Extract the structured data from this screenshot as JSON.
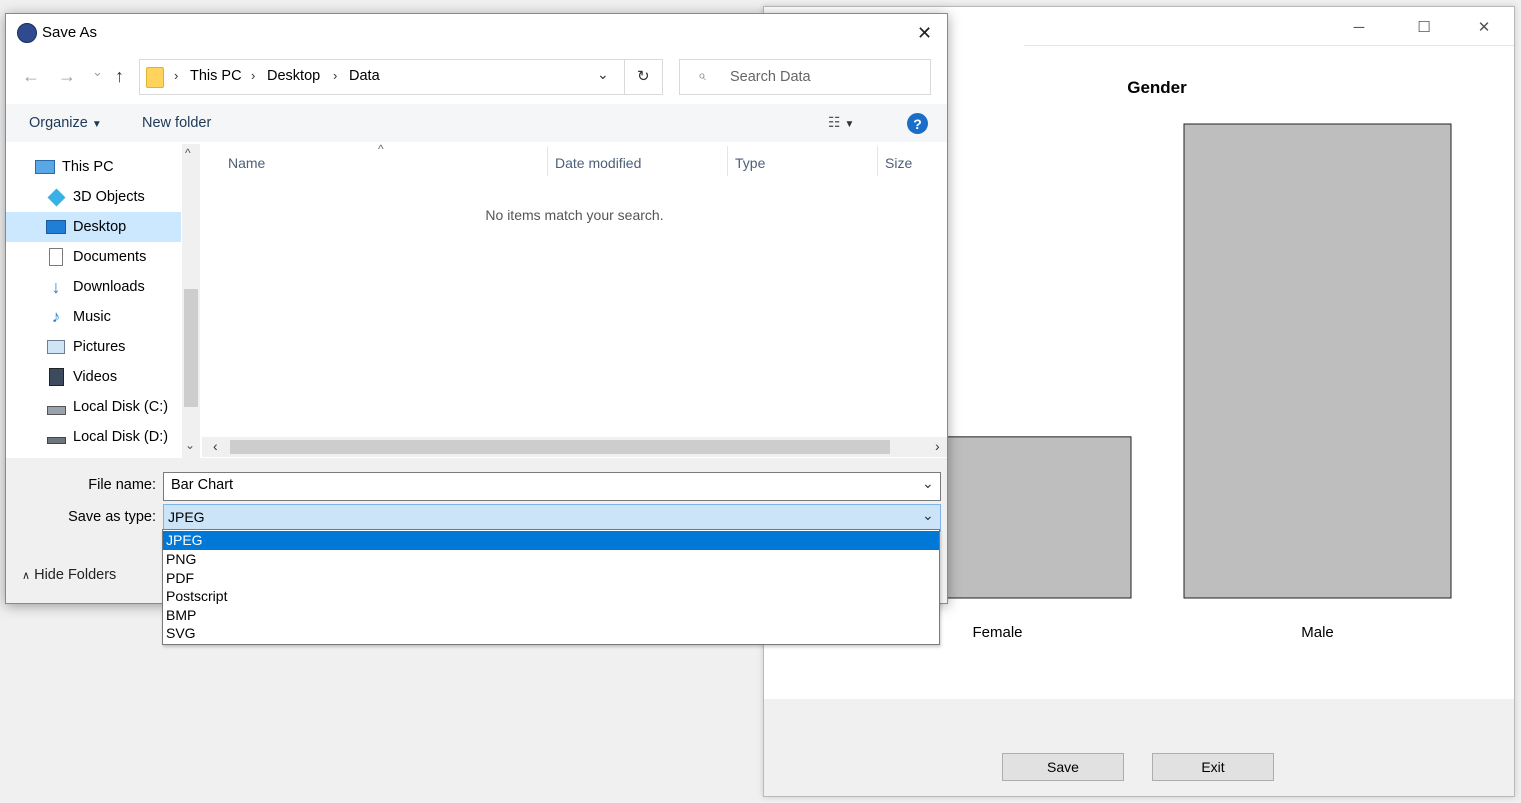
{
  "chart_window": {
    "controls": {
      "minimize": "─",
      "maximize": "☐",
      "close": "✕"
    },
    "save_label": "Save",
    "exit_label": "Exit"
  },
  "chart_data": {
    "type": "bar",
    "title": "Gender",
    "categories": [
      "Female",
      "Male"
    ],
    "values": [
      34,
      100
    ],
    "ylim": [
      0,
      100
    ],
    "bar_color": "#bebebe",
    "grid": false
  },
  "dialog": {
    "title": "Save As",
    "close_glyph": "✕",
    "nav": {
      "back": "←",
      "forward": "→",
      "recent": "⌄",
      "up": "↑"
    },
    "breadcrumb": [
      "This PC",
      "Desktop",
      "Data"
    ],
    "search_placeholder": "Search Data",
    "toolbar": {
      "organize": "Organize",
      "new_folder": "New folder",
      "help": "?"
    },
    "sidebar": [
      {
        "label": "This PC",
        "icon": "computer-icon"
      },
      {
        "label": "3D Objects",
        "icon": "cube-icon"
      },
      {
        "label": "Desktop",
        "icon": "desktop-icon",
        "selected": true
      },
      {
        "label": "Documents",
        "icon": "document-icon"
      },
      {
        "label": "Downloads",
        "icon": "download-icon"
      },
      {
        "label": "Music",
        "icon": "music-icon"
      },
      {
        "label": "Pictures",
        "icon": "picture-icon"
      },
      {
        "label": "Videos",
        "icon": "video-icon"
      },
      {
        "label": "Local Disk (C:)",
        "icon": "drive-icon"
      },
      {
        "label": "Local Disk (D:)",
        "icon": "drive-icon"
      }
    ],
    "columns": [
      "Name",
      "Date modified",
      "Type",
      "Size"
    ],
    "empty_message": "No items match your search.",
    "file_name_label": "File name:",
    "file_name_value": "Bar Chart",
    "save_type_label": "Save as type:",
    "save_type_value": "JPEG",
    "type_options": [
      "JPEG",
      "PNG",
      "PDF",
      "Postscript",
      "BMP",
      "SVG"
    ],
    "hide_folders": "Hide Folders",
    "colors": {
      "accent": "#0078d7",
      "selected_item": "#cce8ff",
      "help": "#1a6ec8"
    }
  }
}
